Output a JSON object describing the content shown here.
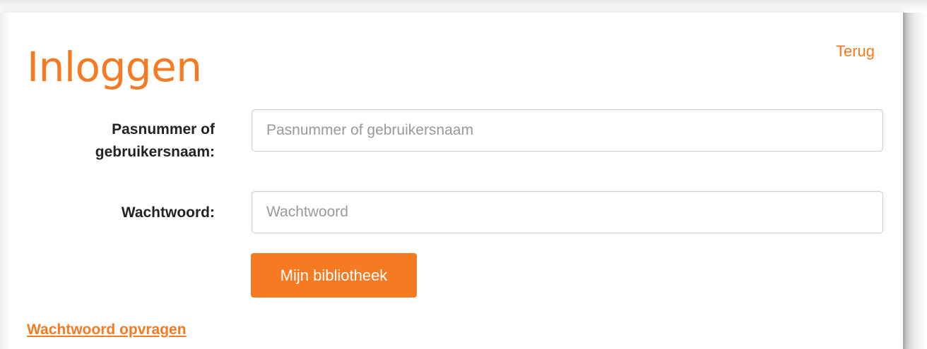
{
  "login": {
    "title": "Inloggen",
    "back_link": "Terug",
    "username": {
      "label": "Pasnummer of gebruikersnaam:",
      "placeholder": "Pasnummer of gebruikersnaam",
      "value": ""
    },
    "password": {
      "label": "Wachtwoord:",
      "placeholder": "Wachtwoord",
      "value": ""
    },
    "submit_label": "Mijn bibliotheek",
    "forgot_password": "Wachtwoord opvragen"
  },
  "colors": {
    "accent": "#f57a21",
    "label_text": "#222222",
    "placeholder_text": "#999999",
    "input_border": "#cccccc"
  }
}
